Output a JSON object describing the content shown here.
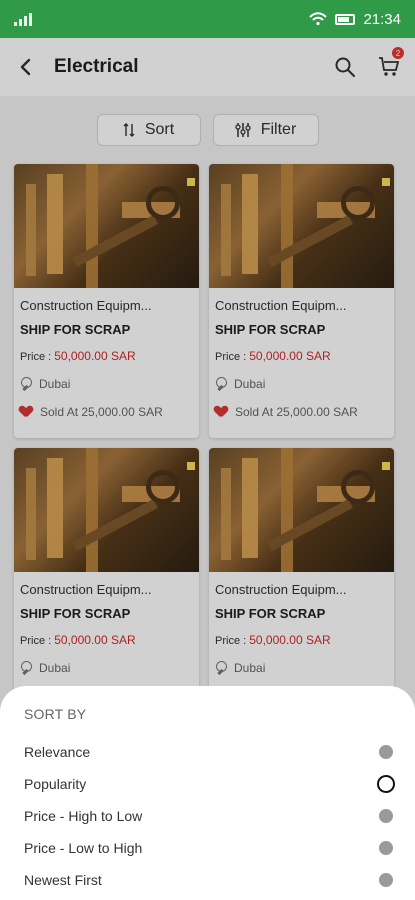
{
  "status_bar": {
    "time": "21:34"
  },
  "header": {
    "title": "Electrical",
    "cart_count": "2"
  },
  "toolbar": {
    "sort_label": "Sort",
    "filter_label": "Filter"
  },
  "products": [
    {
      "category": "Construction Equipm...",
      "name": "SHIP FOR SCRAP",
      "price_label": "Price :",
      "price": "50,000.00 SAR",
      "location": "Dubai",
      "sold_text": "Sold At 25,000.00 SAR"
    },
    {
      "category": "Construction Equipm...",
      "name": "SHIP FOR SCRAP",
      "price_label": "Price :",
      "price": "50,000.00 SAR",
      "location": "Dubai",
      "sold_text": "Sold At 25,000.00 SAR"
    },
    {
      "category": "Construction Equipm...",
      "name": "SHIP FOR SCRAP",
      "price_label": "Price :",
      "price": "50,000.00 SAR",
      "location": "Dubai"
    },
    {
      "category": "Construction Equipm...",
      "name": "SHIP FOR SCRAP",
      "price_label": "Price :",
      "price": "50,000.00 SAR",
      "location": "Dubai"
    }
  ],
  "sort_sheet": {
    "title": "SORT BY",
    "options": [
      {
        "label": "Relevance",
        "selected": false
      },
      {
        "label": "Popularity",
        "selected": true
      },
      {
        "label": "Price - High to Low",
        "selected": false
      },
      {
        "label": "Price - Low to High",
        "selected": false
      },
      {
        "label": "Newest First",
        "selected": false
      }
    ]
  },
  "colors": {
    "status_bar": "#2f9a47",
    "price": "#d12a2a",
    "badge": "#e53935"
  },
  "icons": {
    "back": "chevron-left-icon",
    "search": "search-icon",
    "cart": "cart-icon",
    "sort": "sort-icon",
    "filter": "filter-icon",
    "location": "location-pin-icon",
    "sold": "heart-icon"
  }
}
